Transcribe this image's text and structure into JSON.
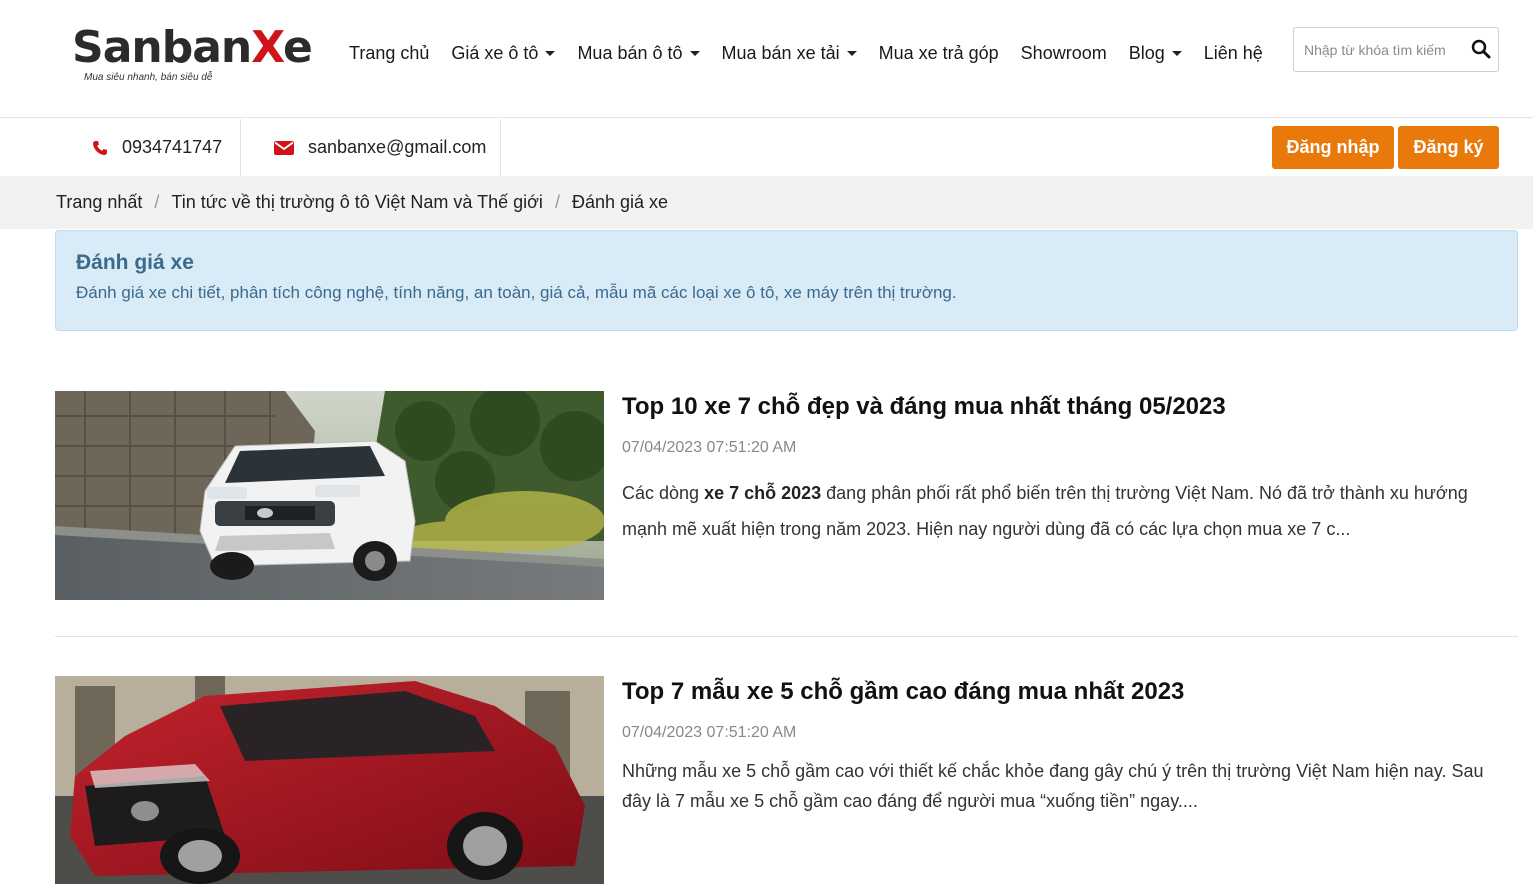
{
  "brand": {
    "logo_main": "Sanban",
    "logo_x": "X",
    "logo_e": "e",
    "tagline": "Mua siêu nhanh, bán siêu dễ"
  },
  "nav": {
    "items": [
      {
        "label": "Trang chủ"
      },
      {
        "label": "Giá xe ô tô"
      },
      {
        "label": "Mua bán ô tô"
      },
      {
        "label": "Mua bán xe tải"
      },
      {
        "label": "Mua xe trả góp"
      },
      {
        "label": "Showroom"
      },
      {
        "label": "Blog"
      },
      {
        "label": "Liên hệ"
      }
    ]
  },
  "search": {
    "placeholder": "Nhập từ khóa tìm kiếm"
  },
  "contact": {
    "phone": "0934741747",
    "email": "sanbanxe@gmail.com"
  },
  "auth": {
    "login": "Đăng nhập",
    "register": "Đăng ký"
  },
  "breadcrumb": {
    "items": [
      "Trang nhất",
      "Tin tức về thị trường ô tô Việt Nam và Thế giới",
      "Đánh giá xe"
    ],
    "separator": "/"
  },
  "category": {
    "title": "Đánh giá xe",
    "description": "Đánh giá xe chi tiết, phân tích công nghệ, tính năng, an toàn, giá cả, mẫu mã các loại xe ô tô, xe máy trên thị trường."
  },
  "articles": [
    {
      "title": "Top 10 xe 7 chỗ đẹp và đáng mua nhất tháng 05/2023",
      "date": "07/04/2023 07:51:20 AM",
      "excerpt_pre": "Các dòng ",
      "excerpt_bold": "xe 7 chỗ 2023",
      "excerpt_post": " đang phân phối rất phổ biến trên thị trường Việt Nam. Nó đã trở thành xu hướng mạnh mẽ xuất hiện trong năm 2023. Hiện nay người dùng đã có các lựa chọn mua xe 7 c...",
      "image": "white-toyota-rush-suv"
    },
    {
      "title": "Top 7 mẫu xe 5 chỗ gầm cao đáng mua nhất 2023",
      "date": "07/04/2023 07:51:20 AM",
      "excerpt": "Những mẫu xe 5 chỗ gầm cao với thiết kế chắc khỏe đang gây chú ý trên thị trường Việt Nam hiện nay. Sau đây là 7 mẫu xe 5 chỗ gầm cao đáng để người mua “xuống tiền” ngay....",
      "image": "red-mazda-cx5-suv"
    }
  ],
  "colors": {
    "brand_red": "#d0121b",
    "button_orange": "#e8790a",
    "info_bg": "#d9ebf7",
    "info_text": "#3a6a8e"
  }
}
